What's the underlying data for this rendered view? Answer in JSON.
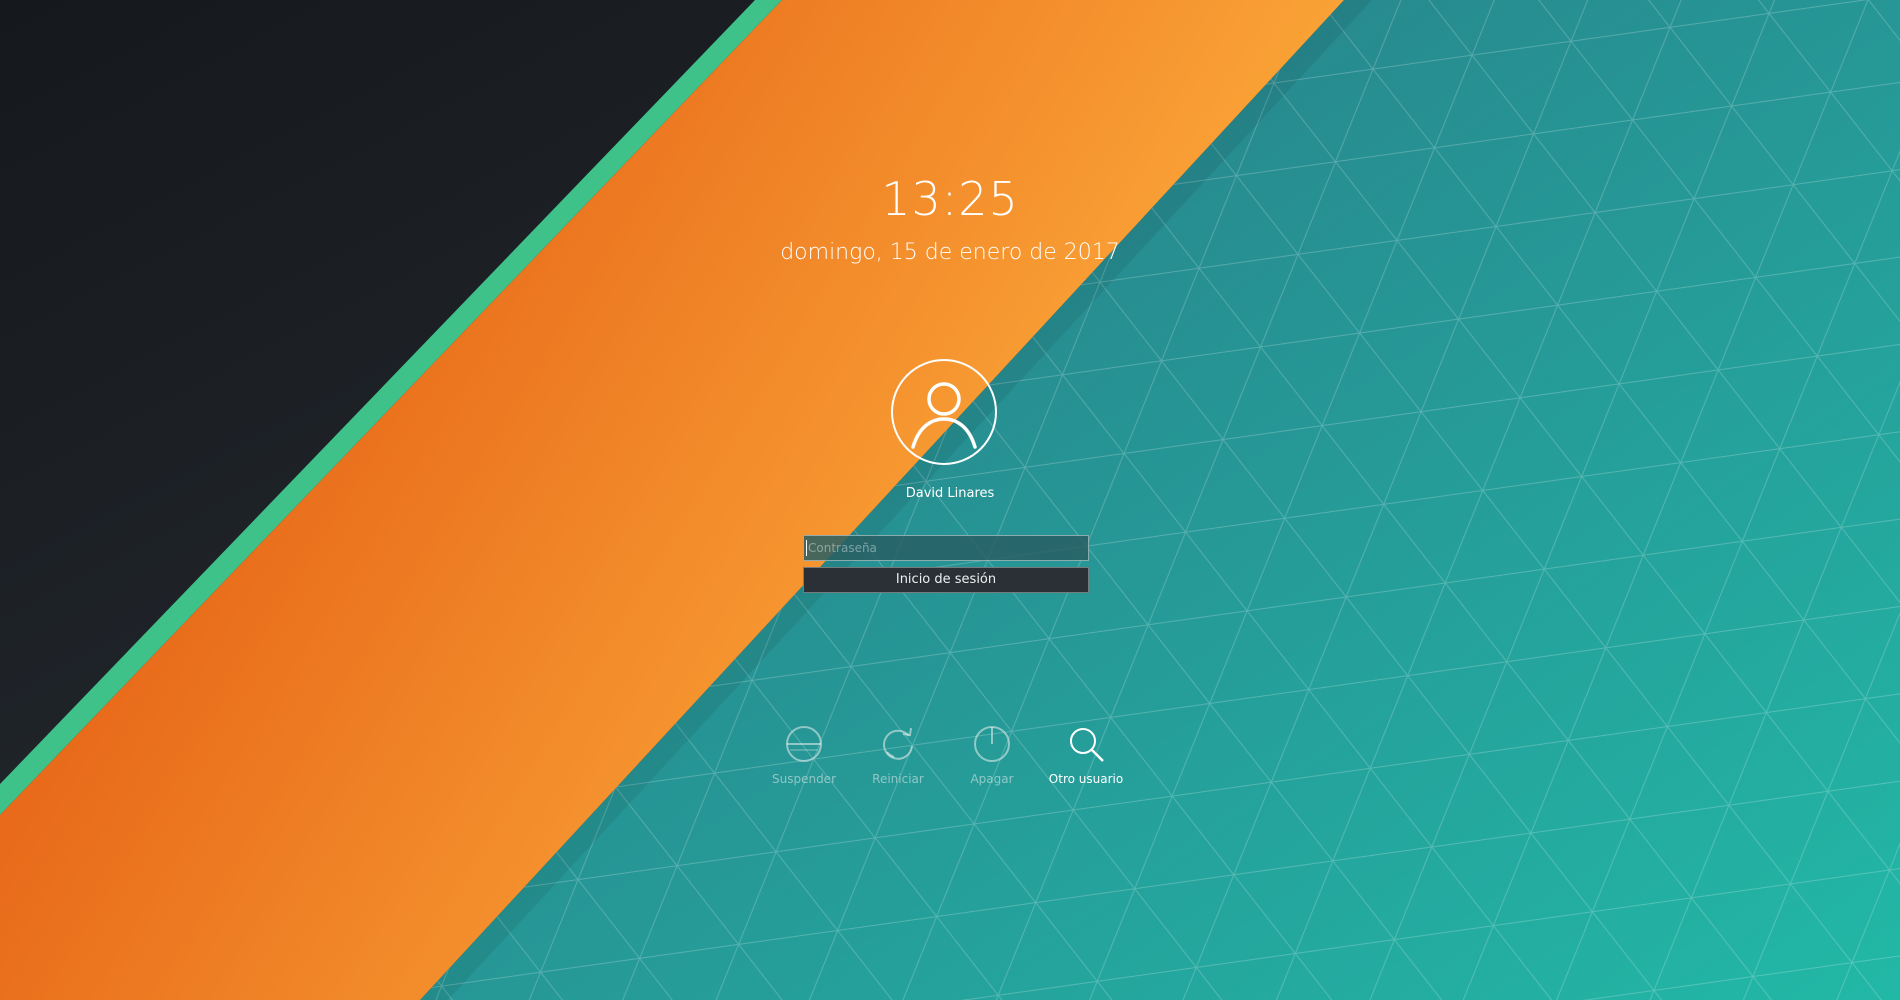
{
  "lockscreen": {
    "clock": "13:25",
    "date": "domingo, 15 de enero de 2017",
    "user": {
      "name": "David Linares",
      "avatar_icon": "user-icon"
    },
    "password": {
      "value": "",
      "placeholder": "Contraseña"
    },
    "login_label": "Inicio de sesión",
    "actions": [
      {
        "label": "Suspender",
        "icon": "suspend-icon"
      },
      {
        "label": "Reiniciar",
        "icon": "restart-icon"
      },
      {
        "label": "Apagar",
        "icon": "power-icon"
      },
      {
        "label": "Otro usuario",
        "icon": "search-icon"
      }
    ]
  },
  "colors": {
    "dark_bg": "#1b1e22",
    "green_stripe": "#3fc18a",
    "orange_start": "#e86a1a",
    "orange_end": "#fba638",
    "teal_start": "#2a7f8c",
    "teal_end": "#25b5a5"
  }
}
